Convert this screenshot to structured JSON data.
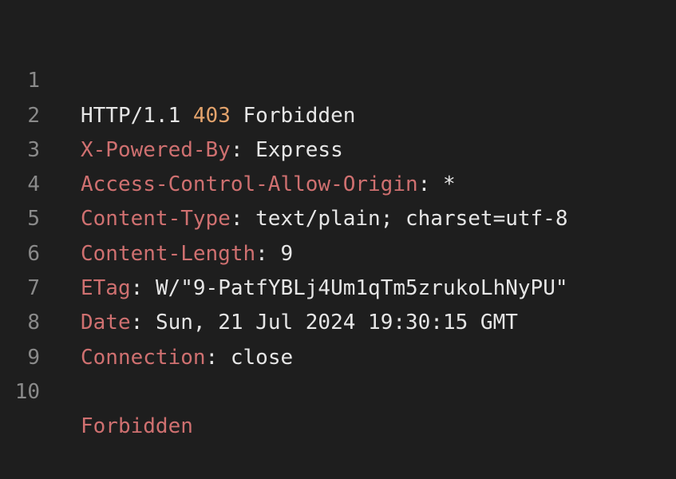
{
  "colors": {
    "background": "#1e1e1e",
    "text": "#e6e6e6",
    "line_number": "#8a8a8a",
    "header_key": "#cf7070",
    "status_code": "#e3a36c"
  },
  "lines": [
    {
      "num": "1",
      "protocol": "HTTP/1.1",
      "status_code": "403",
      "status_text": "Forbidden"
    },
    {
      "num": "2",
      "key": "X-Powered-By",
      "value": "Express"
    },
    {
      "num": "3",
      "key": "Access-Control-Allow-Origin",
      "value": "*"
    },
    {
      "num": "4",
      "key": "Content-Type",
      "value": "text/plain; charset=utf-8"
    },
    {
      "num": "5",
      "key": "Content-Length",
      "value": "9"
    },
    {
      "num": "6",
      "key": "ETag",
      "value": "W/\"9-PatfYBLj4Um1qTm5zrukoLhNyPU\""
    },
    {
      "num": "7",
      "key": "Date",
      "value": "Sun, 21 Jul 2024 19:30:15 GMT"
    },
    {
      "num": "8",
      "key": "Connection",
      "value": "close"
    },
    {
      "num": "9"
    },
    {
      "num": "10",
      "body": "Forbidden"
    }
  ],
  "separator": ": "
}
